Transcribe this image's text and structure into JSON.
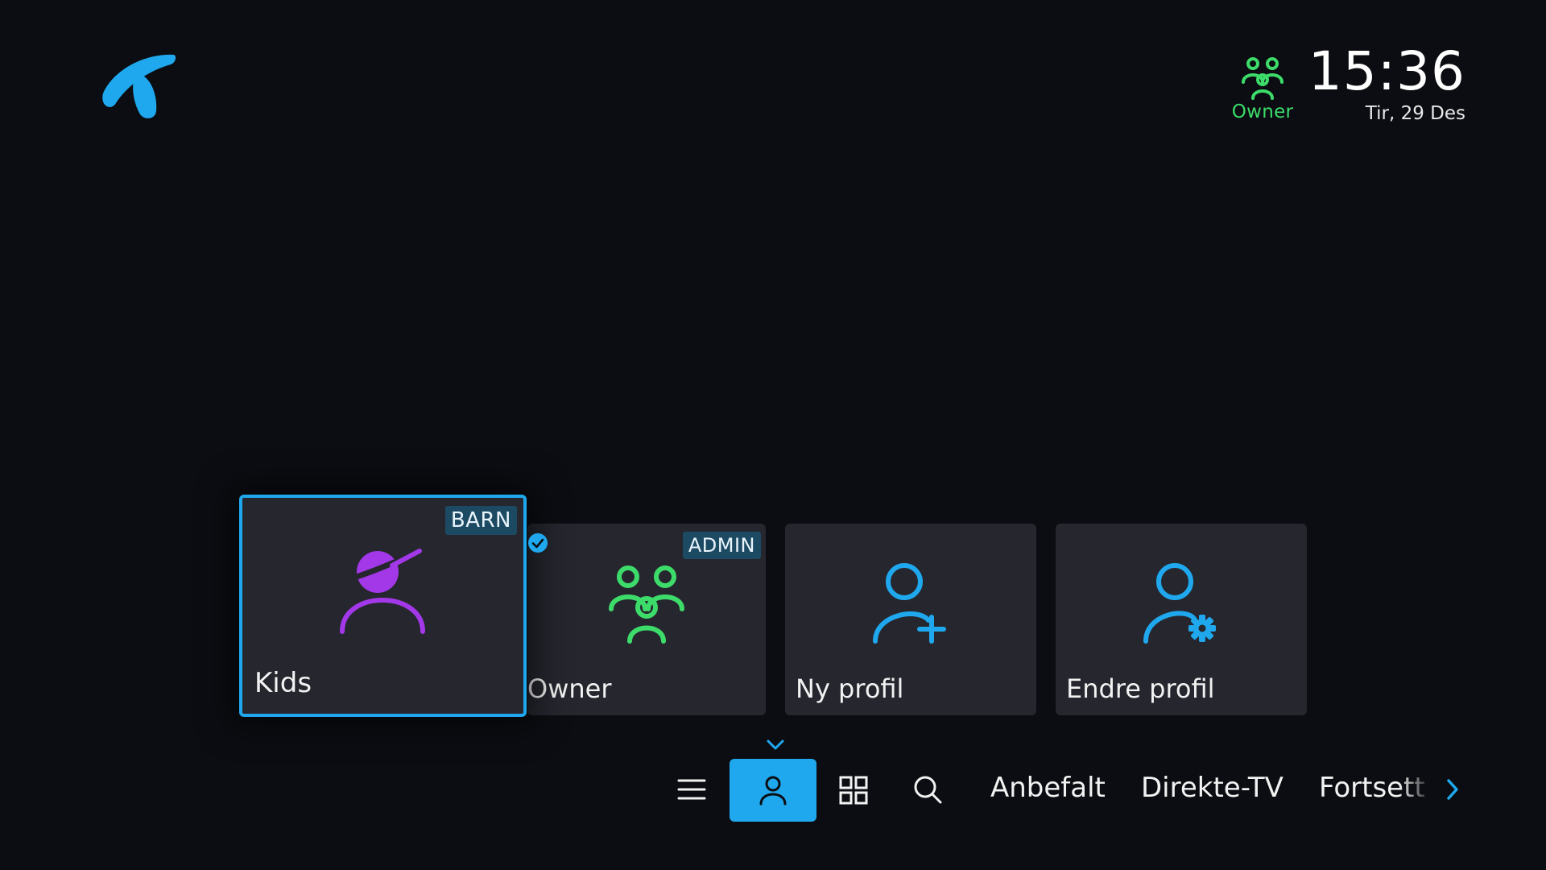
{
  "brand": {
    "logo_icon": "telenor-logo-icon",
    "accent_color": "#1fa8ee"
  },
  "header": {
    "active_profile": {
      "icon": "group-users-icon",
      "label": "Owner",
      "color": "#3ddc6a"
    },
    "clock": {
      "time": "15:36",
      "date": "Tir, 29 Des"
    }
  },
  "profiles": [
    {
      "name": "Kids",
      "badge": "BARN",
      "icon": "kid-user-icon",
      "color": "#a238e8",
      "focused": true
    },
    {
      "name": "Owner",
      "badge": "ADMIN",
      "icon": "group-users-icon",
      "color": "#3ddc6a",
      "active": true,
      "status_icon": "check-circle-icon"
    },
    {
      "name": "Ny profil",
      "icon": "add-user-icon",
      "color": "#1fa8ee"
    },
    {
      "name": "Endre profil",
      "icon": "edit-user-icon",
      "color": "#1fa8ee"
    }
  ],
  "navbar": {
    "indicator_icon": "chevron-down-icon",
    "icons": [
      "menu-icon",
      "profile-icon",
      "grid-icon",
      "search-icon"
    ],
    "links": [
      "Anbefalt",
      "Direkte-TV",
      "Fortsett å"
    ],
    "next_icon": "chevron-right-icon",
    "selected": "profile-icon"
  }
}
